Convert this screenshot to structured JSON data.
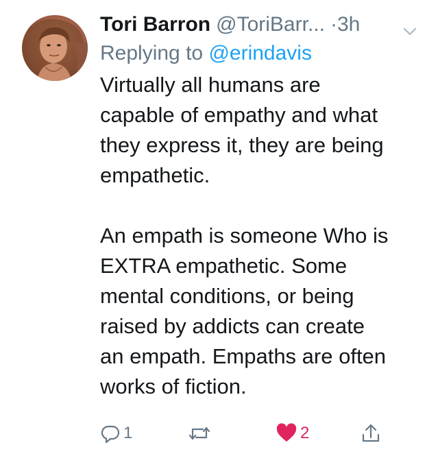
{
  "tweet": {
    "display_name": "Tori Barron",
    "handle": "@ToriBarr...",
    "timestamp": "·3h",
    "reply_prefix": "Replying to",
    "reply_mention": "@erindavis",
    "paragraphs": [
      {
        "lines": [
          "Virtually all humans are",
          "capable of empathy and what",
          "they express it, they are being",
          "empathetic."
        ]
      },
      {
        "lines": [
          "An empath is someone Who is",
          "EXTRA empathetic. Some",
          "mental conditions, or being",
          "raised by addicts can create",
          "an empath. Empaths are often",
          "works of fiction."
        ]
      }
    ]
  },
  "actions": {
    "reply_count": "1",
    "retweet_count": "",
    "like_count": "2",
    "like_state": "liked",
    "icons": [
      "reply-icon",
      "retweet-icon",
      "heart-icon",
      "share-icon"
    ]
  },
  "colors": {
    "text": "#14171a",
    "secondary": "#657786",
    "link": "#1da1f2",
    "like": "#e0245e"
  }
}
